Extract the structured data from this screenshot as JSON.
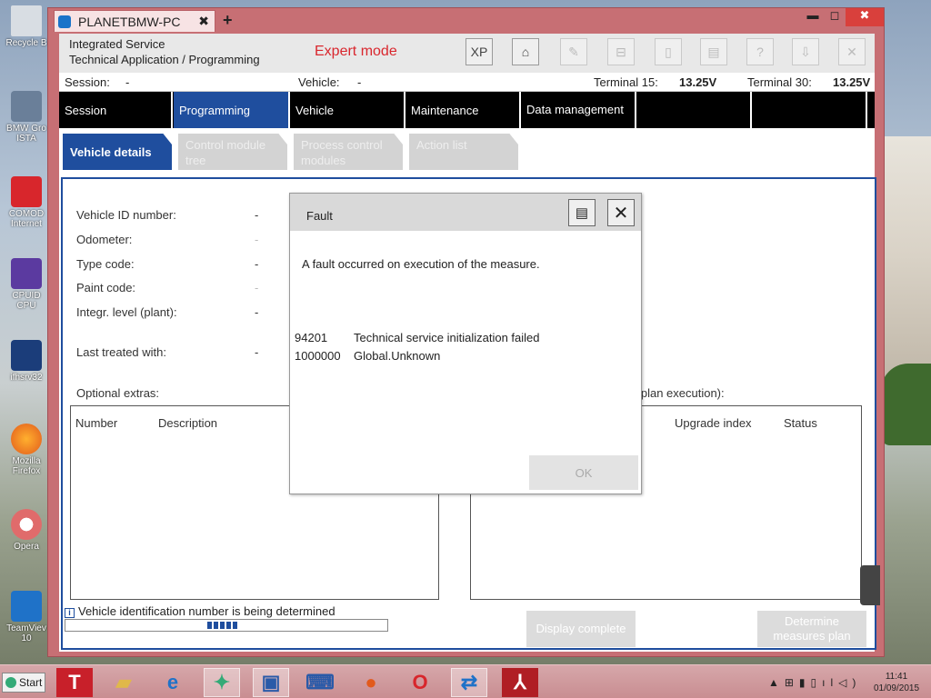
{
  "desktop": {
    "icons": [
      {
        "label": "Recycle B",
        "icon": "recycle-bin-icon"
      },
      {
        "label": "BMW Gro ISTA",
        "icon": "ista-icon"
      },
      {
        "label": "COMOD Internet",
        "icon": "comodo-icon"
      },
      {
        "label": "CPUID CPU",
        "icon": "cpuid-icon"
      },
      {
        "label": "ifhsrv32",
        "icon": "ifhsrv-icon"
      },
      {
        "label": "Mozilla Firefox",
        "icon": "firefox-icon"
      },
      {
        "label": "Opera",
        "icon": "opera-icon"
      },
      {
        "label": "TeamViev 10",
        "icon": "teamviewer-icon"
      }
    ]
  },
  "browser": {
    "tab_title": "PLANETBMW-PC",
    "tab_close": "✖",
    "new_tab": "+",
    "min": "▬",
    "max": "◻",
    "close": "✖"
  },
  "app": {
    "title_line1": "Integrated Service",
    "title_line2": "Technical Application / Programming",
    "mode": "Expert mode",
    "toolbar": {
      "xp": "XP",
      "home_icon": "house-icon",
      "wrench_icon": "wrench-icon",
      "compare_icon": "compare-icon",
      "screenshot_icon": "screenshot-icon",
      "print_icon": "print-icon",
      "help": "?",
      "download_icon": "download-icon",
      "close": "✕"
    },
    "info": {
      "session_label": "Session:",
      "session_value": "-",
      "vehicle_label": "Vehicle:",
      "vehicle_value": "-",
      "terminal15_label": "Terminal 15:",
      "terminal15_value": "13.25V",
      "terminal30_label": "Terminal 30:",
      "terminal30_value": "13.25V"
    },
    "menu": [
      "Session",
      "Programming",
      "Vehicle",
      "Maintenance",
      "Data management",
      "",
      ""
    ],
    "subtabs": [
      "Vehicle details",
      "Control module tree",
      "Process control modules",
      "Action list"
    ],
    "fields": [
      {
        "label": "Vehicle ID number:",
        "value": "-"
      },
      {
        "label": "Odometer:",
        "value": "-"
      },
      {
        "label": "Type code:",
        "value": "-"
      },
      {
        "label": "Paint code:",
        "value": "-"
      },
      {
        "label": "Integr. level (plant):",
        "value": "-"
      },
      {
        "label": "Last treated with:",
        "value": "-"
      }
    ],
    "optional_extras_label": "Optional extras:",
    "left_table": {
      "col1": "Number",
      "col2": "Description"
    },
    "right_label": "e plan execution):",
    "right_table": {
      "col1": "Upgrade index",
      "col2": "Status"
    },
    "status_text": "Vehicle identification number is being determined",
    "progress": 0.1,
    "btn_display_complete": "Display complete",
    "btn_determine": "Determine measures plan"
  },
  "dialog": {
    "title": "Fault",
    "message": "A fault occurred on execution of the measure.",
    "faults": [
      {
        "code": "94201",
        "text": "Technical service initialization failed"
      },
      {
        "code": "1000000",
        "text": "Global.Unknown"
      }
    ],
    "ok": "OK"
  },
  "taskbar": {
    "start": "Start",
    "time": "11:41",
    "date": "01/09/2015"
  }
}
